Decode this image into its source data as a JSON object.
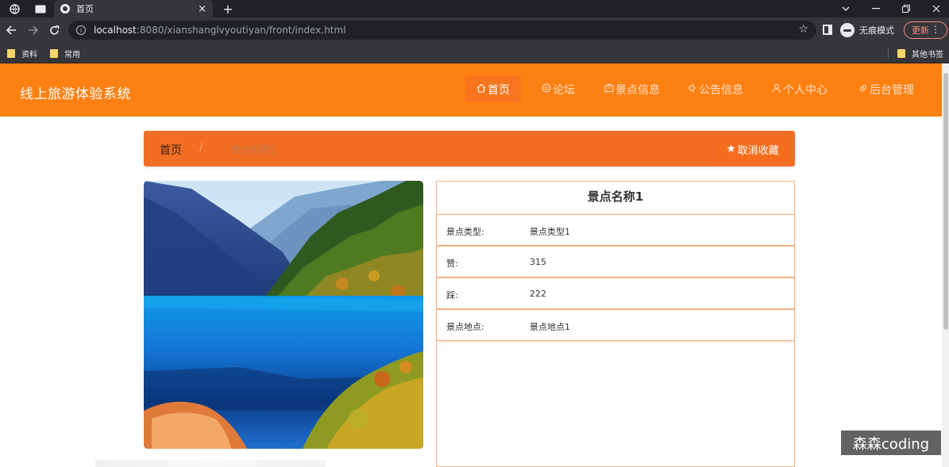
{
  "browser": {
    "tab": {
      "title": "首页",
      "close": "×"
    },
    "new_tab": "+",
    "url": {
      "host": "localhost",
      "path": ":8080/xianshanglvyoutiyan/front/index.html"
    },
    "incognito_label": "无痕模式",
    "update_label": "更新",
    "bookmarks": [
      "资料",
      "常用"
    ],
    "other_bookmarks": "其他书签"
  },
  "site": {
    "title": "线上旅游体验系统",
    "nav": [
      {
        "label": "首页",
        "icon": "home-icon",
        "active": true
      },
      {
        "label": "论坛",
        "icon": "forum-icon",
        "active": false
      },
      {
        "label": "景点信息",
        "icon": "scenic-icon",
        "active": false
      },
      {
        "label": "公告信息",
        "icon": "notice-icon",
        "active": false
      },
      {
        "label": "个人中心",
        "icon": "user-icon",
        "active": false
      },
      {
        "label": "后台管理",
        "icon": "link-icon",
        "active": false
      }
    ]
  },
  "breadcrumb": {
    "home": "首页",
    "separator": "/",
    "current": "景点名称1"
  },
  "favorite_button": "取消收藏",
  "detail": {
    "title": "景点名称1",
    "rows": [
      {
        "label": "景点类型:",
        "value": "景点类型1"
      },
      {
        "label": "赞:",
        "value": "315"
      },
      {
        "label": "踩:",
        "value": "222"
      },
      {
        "label": "景点地点:",
        "value": "景点地点1"
      }
    ]
  },
  "watermark": "森森coding",
  "colors": {
    "header": "#fd8013",
    "breadcrumb": "#f26e24",
    "accent": "#f66d1e",
    "browser_dark": "#202124",
    "browser_toolbar": "#35363a"
  }
}
